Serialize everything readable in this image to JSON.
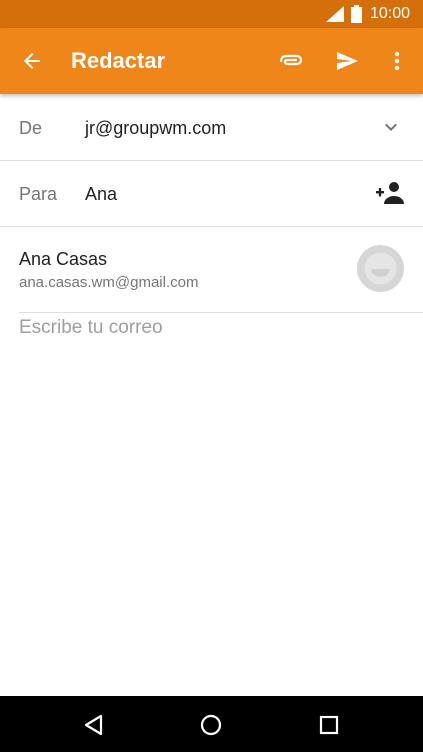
{
  "status_bar": {
    "time": "10:00"
  },
  "app_bar": {
    "title": "Redactar"
  },
  "from": {
    "label": "De",
    "value": "jr@groupwm.com"
  },
  "to": {
    "label": "Para",
    "value": "Ana"
  },
  "suggestion": {
    "name": "Ana Casas",
    "email": "ana.casas.wm@gmail.com"
  },
  "compose": {
    "placeholder": "Escribe tu correo"
  },
  "colors": {
    "app_bar": "#ef8619",
    "status_bar": "#d4700c",
    "nav_bar": "#000000",
    "divider": "#e0e0e0"
  },
  "icons": {
    "back": "arrow-left-icon",
    "attach": "paperclip-icon",
    "send": "send-icon",
    "more": "more-vert-icon",
    "from_dropdown": "chevron-down-icon",
    "add_contact": "add-person-icon",
    "avatar": "contact-avatar",
    "nav_back": "triangle-back-icon",
    "nav_home": "circle-home-icon",
    "nav_recent": "square-recent-icon"
  }
}
